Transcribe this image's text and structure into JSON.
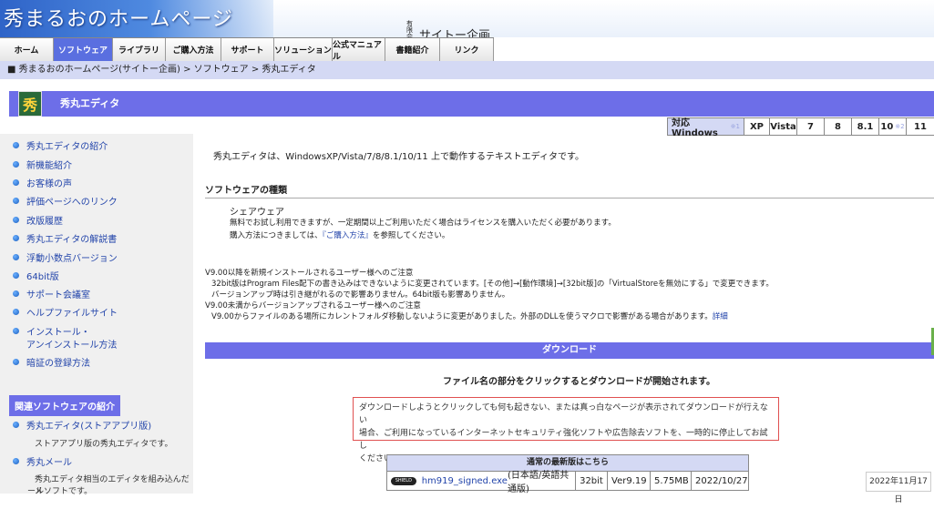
{
  "header": {
    "site_title": "秀まるおのホームページ",
    "company_prefix": "有限会社",
    "company_name": "サイトー企画"
  },
  "nav": [
    {
      "label": "ホーム",
      "w": 58
    },
    {
      "label": "ソフトウェア",
      "w": 64,
      "active": true
    },
    {
      "label": "ライブラリ",
      "w": 57
    },
    {
      "label": "ご購入方法",
      "w": 60
    },
    {
      "label": "サポート",
      "w": 57
    },
    {
      "label": "ソリューション",
      "w": 63
    },
    {
      "label": "公式マニュアル",
      "w": 57
    },
    {
      "label": "書籍紹介",
      "w": 59
    },
    {
      "label": "リンク",
      "w": 58
    }
  ],
  "breadcrumb": "■ 秀まるおのホームページ(サイトー企画) > ソフトウェア > 秀丸エディタ",
  "banner": {
    "logo_glyph": "秀",
    "title": "秀丸エディタ"
  },
  "compat": {
    "head": "対応 Windows",
    "head_note": "※1",
    "versions": [
      {
        "label": "XP"
      },
      {
        "label": "Vista"
      },
      {
        "label": "7"
      },
      {
        "label": "8"
      },
      {
        "label": "8.1"
      },
      {
        "label": "10",
        "note": "※2"
      },
      {
        "label": "11"
      }
    ]
  },
  "sidebar": {
    "links": [
      "秀丸エディタの紹介",
      "新機能紹介",
      "お客様の声",
      "評価ページへのリンク",
      "改版履歴",
      "秀丸エディタの解説書",
      "浮動小数点バージョン",
      "64bit版",
      "サポート会議室",
      "ヘルプファイルサイト",
      "インストール・",
      "アンインストール方法",
      "暗証の登録方法"
    ],
    "related_heading": "関連ソフトウェアの紹介",
    "related": [
      {
        "label": "秀丸エディタ(ストアアプリ版)",
        "desc": "ストアアプリ版の秀丸エディタです。"
      },
      {
        "label": "秀丸メール",
        "desc": "秀丸エディタ相当のエディタを組み込んだメ",
        "desc2": "ールソフトです。"
      }
    ]
  },
  "main": {
    "intro": "秀丸エディタは、WindowsXP/Vista/7/8/8.1/10/11 上で動作するテキストエディタです。",
    "kind_heading": "ソフトウェアの種類",
    "kind_name": "シェアウェア",
    "kind_line1": "無料でお試し利用できますが、一定期間以上ご利用いただく場合はライセンスを購入いただく必要があります。",
    "kind_line2_pre": "購入方法につきましては、",
    "kind_link": "『ご購入方法』",
    "kind_line2_post": "を参照してください。",
    "notice1_title": "V9.00以降を新規インストールされるユーザー様へのご注意",
    "notice1_line1": "32bit版はProgram Files配下の書き込みはできないように変更されています。[その他]→[動作環境]→[32bit版]の「VirtualStoreを無効にする」で変更できます。",
    "notice1_line2": "バージョンアップ時は引き継がれるので影響ありません。64bit版も影響ありません。",
    "notice2_title": "V9.00未満からバージョンアップされるユーザー様へのご注意",
    "notice2_line1": "V9.00からファイルのある場所にカレントフォルダ移動しないように変更がありました。外部のDLLを使うマクロで影響がある場合があります。",
    "notice2_link": "詳細",
    "download_heading": "ダウンロード",
    "download_instruction": "ファイル名の部分をクリックするとダウンロードが開始されます。",
    "warning_line1": "ダウンロードしようとクリックしても何も起きない、または真っ白なページが表示されてダウンロードが行えない",
    "warning_line2": "場合、ご利用になっているインターネットセキュリティ強化ソフトや広告除去ソフトを、一時的に停止してお試し",
    "warning_line3": "ください。",
    "table_heading": "通常の最新版はこちら",
    "shield_label": "SHIELD",
    "file_name": "hm919_signed.exe",
    "file_lang": "(日本語/英語共通版)",
    "file_bits": "32bit",
    "file_version": "Ver9.19",
    "file_size": "5.75MB",
    "file_date": "2022/10/27"
  },
  "date_badge": "2022年11月17日"
}
